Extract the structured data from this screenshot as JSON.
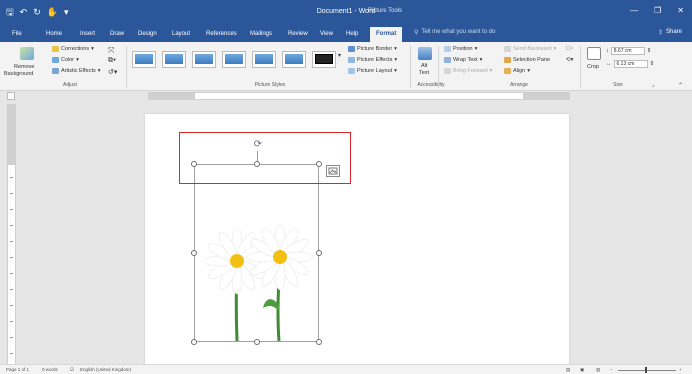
{
  "window": {
    "title": "Document1 - Word",
    "contextual_tab": "Picture Tools"
  },
  "qat": {
    "save_icon": "save-icon",
    "undo_icon": "undo-icon",
    "redo_icon": "redo-icon",
    "touch_icon": "touch-mode-icon",
    "customize_icon": "customize-qat-icon"
  },
  "tabs": [
    "File",
    "Home",
    "Insert",
    "Draw",
    "Design",
    "Layout",
    "References",
    "Mailings",
    "Review",
    "View",
    "Help",
    "Format"
  ],
  "active_tab": "Format",
  "tell_me": "Tell me what you want to do",
  "share": "Share",
  "ribbon": {
    "adjust": {
      "label": "Adjust",
      "remove_bg_line1": "Remove",
      "remove_bg_line2": "Background",
      "corrections": "Corrections",
      "color": "Color",
      "artistic": "Artistic Effects"
    },
    "styles": {
      "label": "Picture Styles",
      "border": "Picture Border",
      "effects": "Picture Effects",
      "layout": "Picture Layout"
    },
    "accessibility": {
      "label": "Accessibility",
      "alt_line1": "Alt",
      "alt_line2": "Text"
    },
    "arrange": {
      "label": "Arrange",
      "position": "Position",
      "wrap": "Wrap Text",
      "bring": "Bring Forward",
      "send": "Send Backward",
      "selection": "Selection Pane",
      "align": "Align"
    },
    "size": {
      "label": "Size",
      "crop": "Crop",
      "height": "8.67 cm",
      "width": "6.13 cm"
    }
  },
  "status": {
    "page": "Page 1 of 1",
    "words": "0 words",
    "language": "English (United Kingdom)"
  },
  "colors": {
    "accent": "#2b579a",
    "selection_highlight": "#d9262b"
  }
}
